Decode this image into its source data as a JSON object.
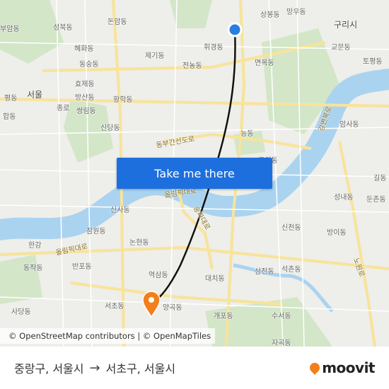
{
  "map": {
    "labels": [
      "돈암동",
      "성북동",
      "부암동",
      "혜화동",
      "동숭동",
      "제기동",
      "휘경동",
      "상봉동",
      "망우동",
      "구리시",
      "교문동",
      "토평동",
      "면목동",
      "전농동",
      "효제동",
      "방산동",
      "황학동",
      "서울",
      "쌍림동",
      "신당동",
      "종로",
      "평동",
      "합동",
      "동부간선도로",
      "능동",
      "암사동",
      "구의동",
      "길동",
      "성내동",
      "둔촌동",
      "신사동",
      "잠원동",
      "논현동",
      "한강",
      "올림픽대로",
      "반포동",
      "동작동",
      "역삼동",
      "대치동",
      "삼전동",
      "석촌동",
      "방이동",
      "신천동",
      "서초동",
      "양곡동",
      "개포동",
      "수서동",
      "사당동",
      "자곡동",
      "올림픽대로",
      "강변북로",
      "송파대로",
      "노원로"
    ],
    "colors": {
      "water": "#aad3f0",
      "park": "#cfe5c3",
      "road": "#fbe9a0",
      "route": "#111111",
      "origin": "#2a7de1",
      "destination": "#f27f1b"
    }
  },
  "cta": {
    "label": "Take me there"
  },
  "attribution": "© OpenStreetMap contributors | © OpenMapTiles",
  "footer": {
    "origin": "중랑구, 서울시",
    "arrow": "→",
    "destination": "서초구, 서울시",
    "brand": "moovit"
  }
}
